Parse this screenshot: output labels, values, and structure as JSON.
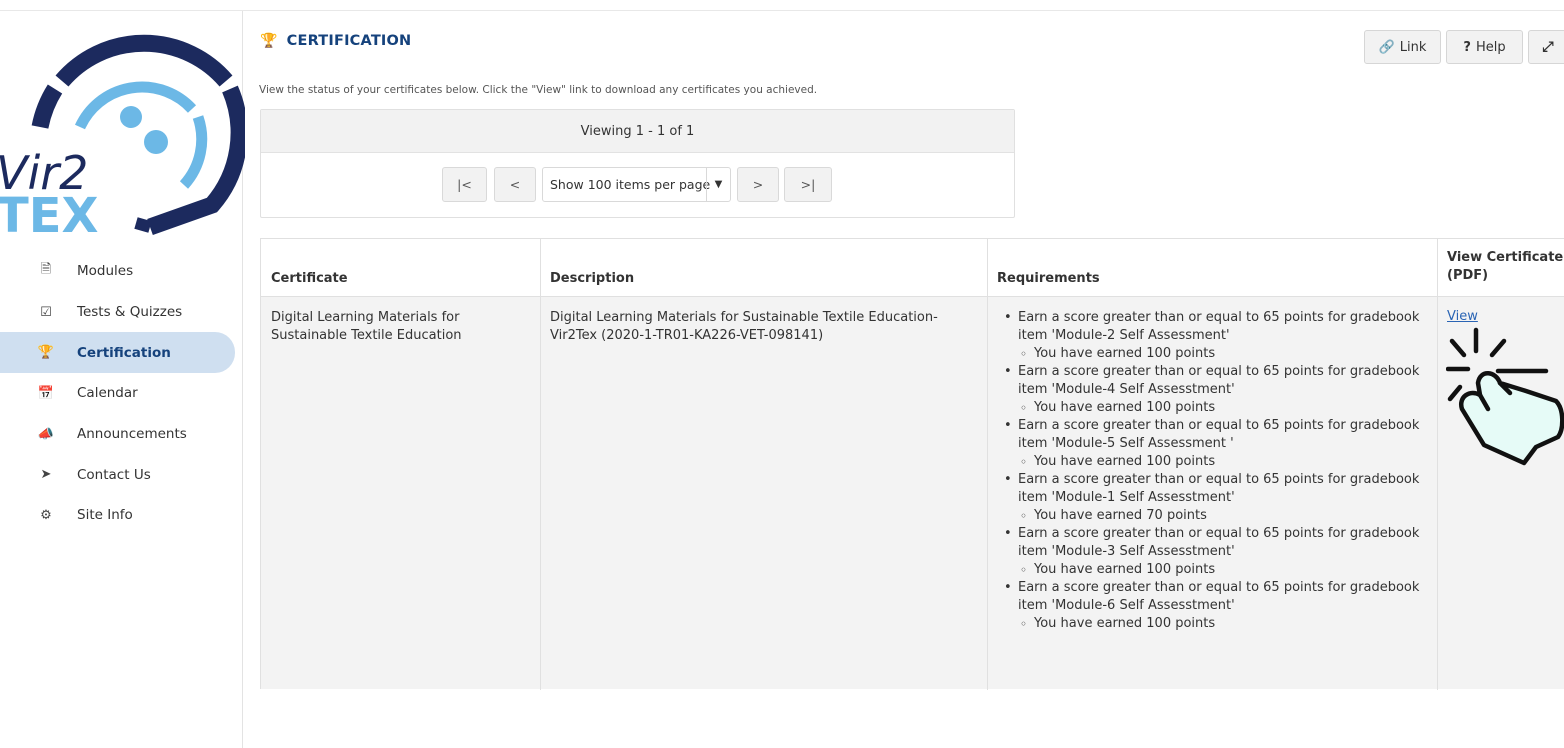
{
  "sidebar": {
    "logo_text": "Vir2 TEX",
    "items": [
      {
        "label": "Modules",
        "icon": "document-icon"
      },
      {
        "label": "Tests & Quizzes",
        "icon": "checkbox-icon"
      },
      {
        "label": "Certification",
        "icon": "trophy-icon",
        "active": true
      },
      {
        "label": "Calendar",
        "icon": "calendar-icon"
      },
      {
        "label": "Announcements",
        "icon": "megaphone-icon"
      },
      {
        "label": "Contact Us",
        "icon": "paper-plane-icon"
      },
      {
        "label": "Site Info",
        "icon": "gear-icon"
      }
    ]
  },
  "header": {
    "title": "CERTIFICATION",
    "link_label": "Link",
    "help_label": "Help",
    "fullscreen_icon": "expand-icon"
  },
  "intro": "View the status of your certificates below. Click the \"View\" link to download any certificates you achieved.",
  "pager": {
    "status": "Viewing 1 - 1 of 1",
    "first": "|<",
    "prev": "<",
    "page_size": "Show 100 items per page",
    "next": ">",
    "last": ">|"
  },
  "table": {
    "headers": {
      "certificate": "Certificate",
      "description": "Description",
      "requirements": "Requirements",
      "view_line1": "View Certificate",
      "view_line2": "(PDF)"
    },
    "row": {
      "certificate_line1": "Digital Learning Materials for",
      "certificate_line2": "Sustainable Textile Education",
      "description_line1": "Digital Learning Materials for Sustainable Textile Education-",
      "description_line2": "Vir2Tex (2020-1-TR01-KA226-VET-098141)",
      "view_label": "View",
      "requirements": [
        {
          "line1": "Earn a score greater than or equal to 65 points for gradebook",
          "line2": "item 'Module-2 Self Assessment'",
          "earned": "You have earned 100 points"
        },
        {
          "line1": "Earn a score greater than or equal to 65 points for gradebook",
          "line2": "item 'Module-4 Self Assesstment'",
          "earned": "You have earned 100 points"
        },
        {
          "line1": "Earn a score greater than or equal to 65 points for gradebook",
          "line2": "item 'Module-5 Self Assessment '",
          "earned": "You have earned 100 points"
        },
        {
          "line1": "Earn a score greater than or equal to 65 points for gradebook",
          "line2": "item 'Module-1 Self Assesstment'",
          "earned": "You have earned 70 points"
        },
        {
          "line1": "Earn a score greater than or equal to 65 points for gradebook",
          "line2": "item 'Module-3 Self Assesstment'",
          "earned": "You have earned 100 points"
        },
        {
          "line1": "Earn a score greater than or equal to 65 points for gradebook",
          "line2": "item 'Module-6 Self Assesstment'",
          "earned": "You have earned 100 points"
        }
      ]
    }
  },
  "colors": {
    "brand_dark": "#1c2a5e",
    "brand_light": "#6cb8e6",
    "accent": "#15427c",
    "link": "#2a64b4",
    "pointer_fill": "#e6fbf7"
  }
}
